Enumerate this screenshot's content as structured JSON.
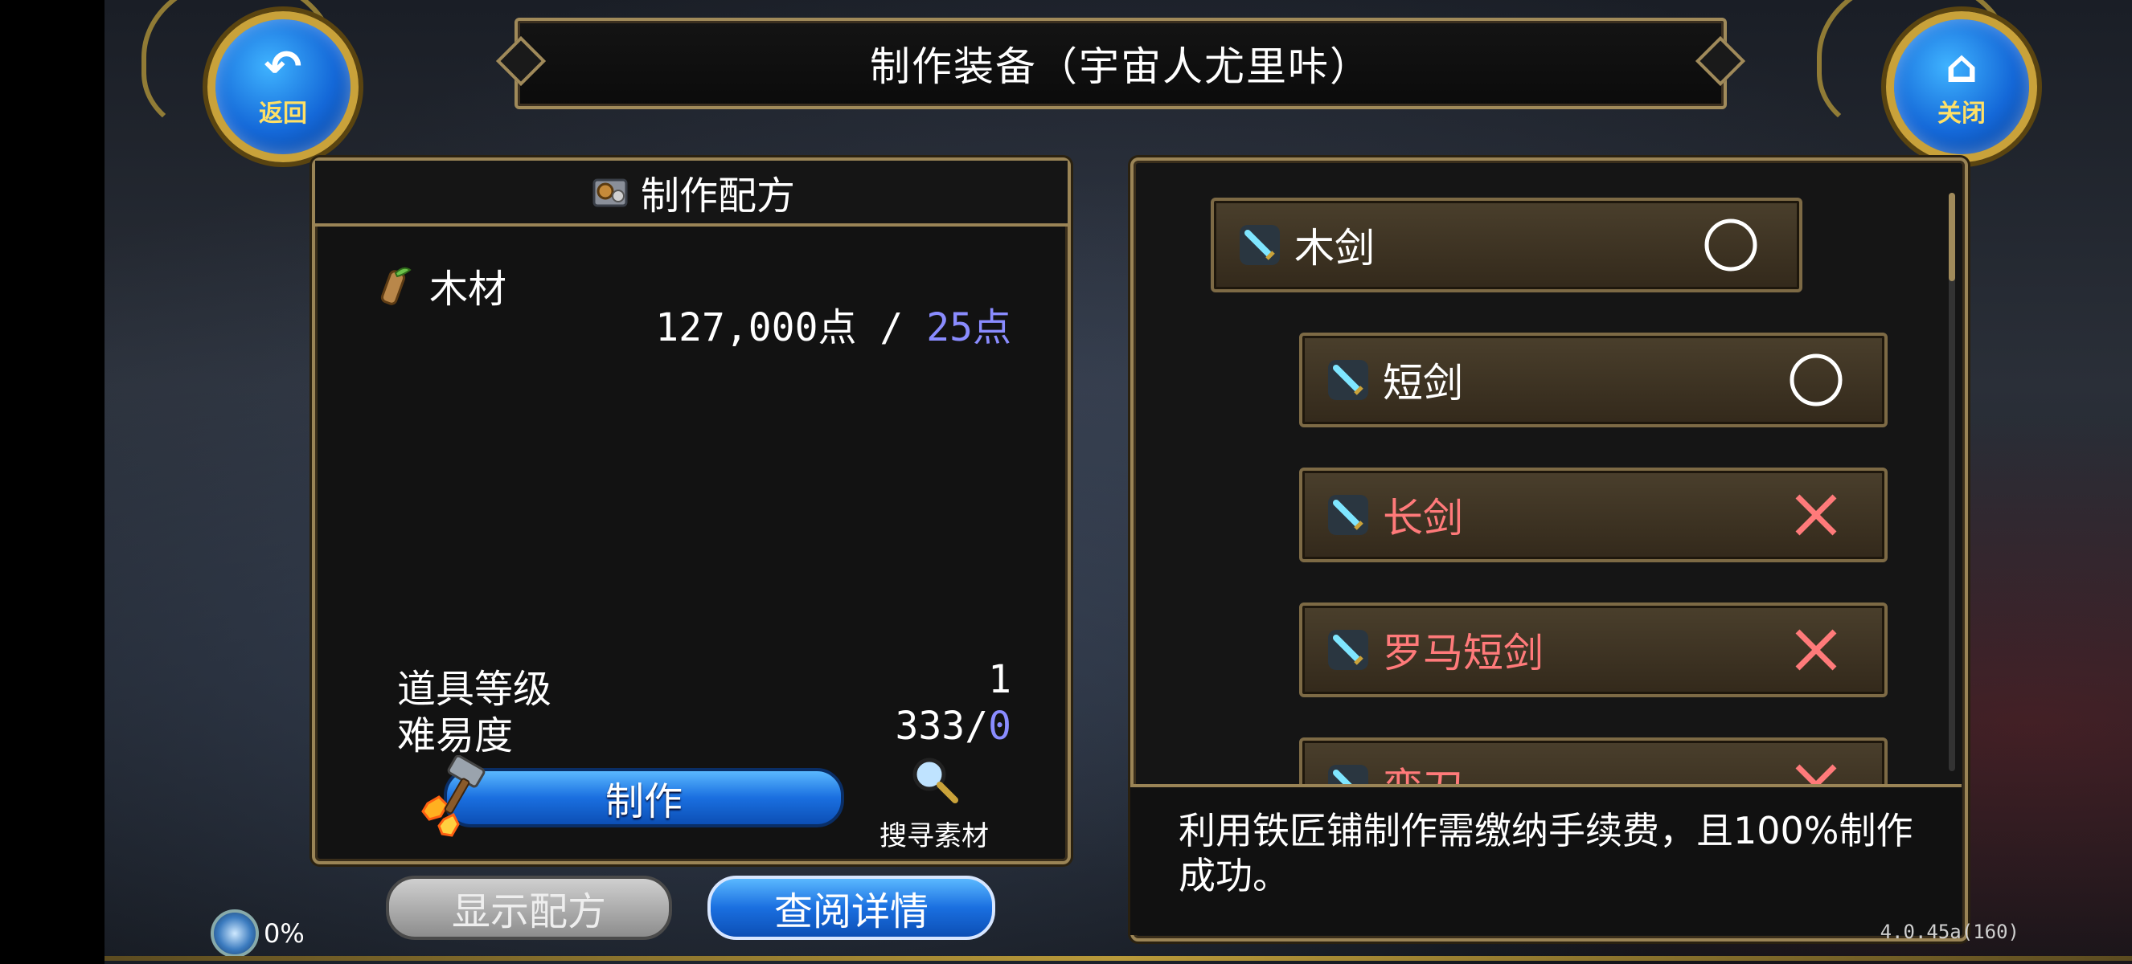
{
  "header": {
    "title": "制作装备（宇宙人尤里咔）"
  },
  "nav": {
    "back_label": "返回",
    "close_label": "关闭"
  },
  "recipe_panel": {
    "title": "制作配方",
    "material_name": "木材",
    "points_current": "127,000点 / ",
    "points_cost": "25点",
    "item_level_label": "道具等级",
    "item_level_value": "1",
    "difficulty_label": "难易度",
    "difficulty_value": "333/",
    "difficulty_extra": "0",
    "make_label": "制作",
    "search_label": "搜寻素材"
  },
  "bottom_buttons": {
    "show_recipe_label": "显示配方",
    "details_label": "查阅详情"
  },
  "progress": {
    "percent_label": "0%"
  },
  "weapon_list": {
    "items": [
      {
        "name": "木剑",
        "status": "available"
      },
      {
        "name": "短剑",
        "status": "available"
      },
      {
        "name": "长剑",
        "status": "unavailable"
      },
      {
        "name": "罗马短剑",
        "status": "unavailable"
      },
      {
        "name": "弯刀",
        "status": "unavailable"
      }
    ]
  },
  "description": "利用铁匠铺制作需缴纳手续费，且100%制作成功。",
  "version": "4.0.45a(160)",
  "colors": {
    "accent_blue": "#1a6fe0",
    "frame_gold": "#a08a5a",
    "unavailable_red": "#ff7a7a",
    "highlight_purple": "#8a8cff"
  }
}
